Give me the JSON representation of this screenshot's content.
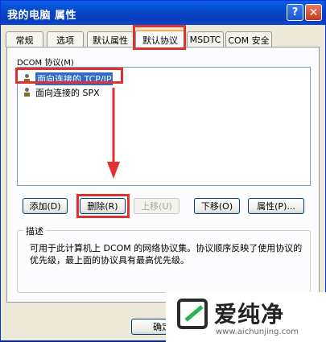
{
  "window": {
    "title": "我的电脑 属性",
    "help_symbol": "?",
    "close_symbol": "✕"
  },
  "tabs": [
    {
      "label": "常规"
    },
    {
      "label": "选项"
    },
    {
      "label": "默认属性"
    },
    {
      "label": "默认协议",
      "active": true
    },
    {
      "label": "MSDTC"
    },
    {
      "label": "COM 安全"
    }
  ],
  "protocols": {
    "label": "DCOM 协议(M)",
    "items": [
      {
        "label": "面向连接的 TCP/IP",
        "selected": true
      },
      {
        "label": "面向连接的 SPX",
        "selected": false
      }
    ]
  },
  "buttons": {
    "add": "添加(D)",
    "remove": "删除(R)",
    "up": "上移(U)",
    "down": "下移(O)",
    "properties": "属性(P)..."
  },
  "description": {
    "title": "描述",
    "text": "可用于此计算机上 DCOM 的网络协议集。协议顺序反映了使用协议的优先级，最上面的协议具有最高优先级。"
  },
  "footer": {
    "ok": "确定"
  },
  "watermark": {
    "brand": "爱纯净",
    "url": "www.aichunjing.com"
  },
  "colors": {
    "highlight": "#e03030",
    "accent": "#316ac5",
    "title_bar": "#0a5fe8"
  }
}
